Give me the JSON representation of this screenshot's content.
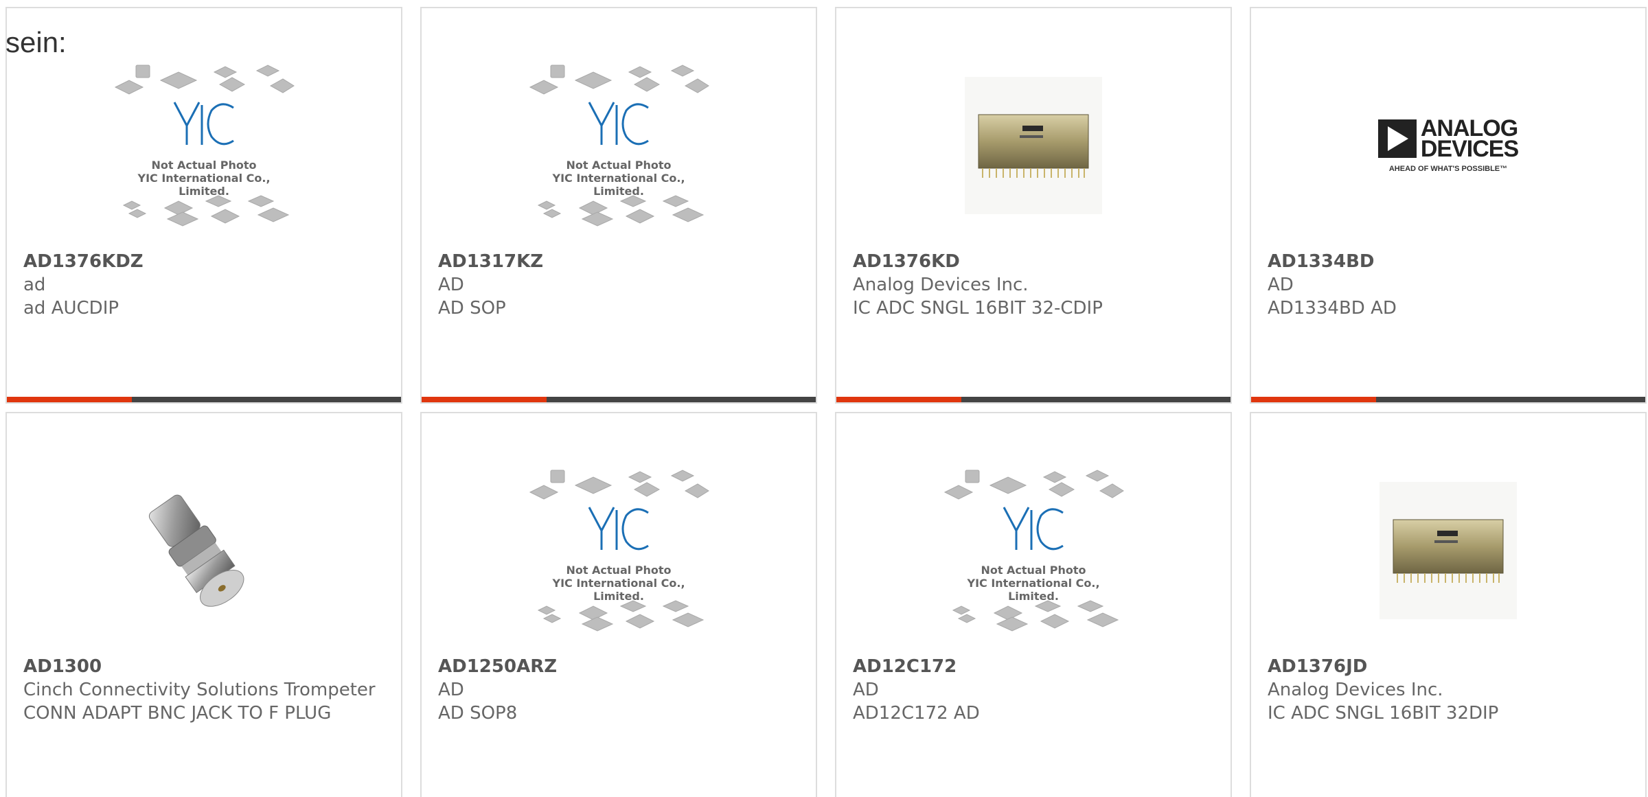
{
  "header": {
    "label": "sein:"
  },
  "placeholder": {
    "line1": "Not Actual Photo",
    "line2": "YIC International Co., Limited."
  },
  "logo": {
    "line1": "ANALOG",
    "line2": "DEVICES",
    "tagline": "AHEAD OF WHAT'S POSSIBLE™"
  },
  "colors": {
    "accent": "#e0360e",
    "bar": "#444444",
    "border": "#dddddd",
    "text": "#666666"
  },
  "products": [
    {
      "part": "AD1376KDZ",
      "manufacturer": "ad",
      "description": "ad AUCDIP",
      "image": "yic-placeholder"
    },
    {
      "part": "AD1317KZ",
      "manufacturer": "AD",
      "description": "AD SOP",
      "image": "yic-placeholder"
    },
    {
      "part": "AD1376KD",
      "manufacturer": "Analog Devices Inc.",
      "description": "IC ADC SNGL 16BIT 32-CDIP",
      "image": "cdip-chip-photo"
    },
    {
      "part": "AD1334BD",
      "manufacturer": "AD",
      "description": "AD1334BD AD",
      "image": "analog-devices-logo"
    },
    {
      "part": "AD1300",
      "manufacturer": "Cinch Connectivity Solutions Trompeter",
      "description": "CONN ADAPT BNC JACK TO F PLUG",
      "image": "bnc-adapter-photo"
    },
    {
      "part": "AD1250ARZ",
      "manufacturer": "AD",
      "description": "AD SOP8",
      "image": "yic-placeholder"
    },
    {
      "part": "AD12C172",
      "manufacturer": "AD",
      "description": "AD12C172 AD",
      "image": "yic-placeholder"
    },
    {
      "part": "AD1376JD",
      "manufacturer": "Analog Devices Inc.",
      "description": "IC ADC SNGL 16BIT 32DIP",
      "image": "cdip-chip-photo"
    }
  ]
}
